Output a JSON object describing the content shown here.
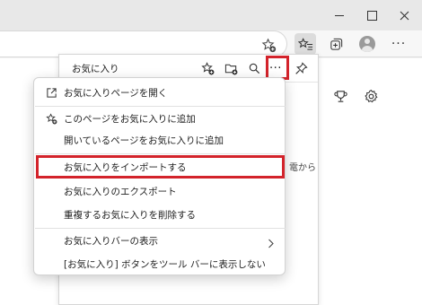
{
  "favorites_panel": {
    "title": "お気に入り",
    "background_text": "電から"
  },
  "menu": {
    "items": [
      {
        "label": "お気に入りページを開く",
        "icon": "open-external-icon"
      },
      {
        "label": "このページをお気に入りに追加",
        "icon": "star-add-icon"
      },
      {
        "label": "開いているページをお気に入りに追加",
        "icon": ""
      },
      {
        "label": "お気に入りをインポートする",
        "icon": "",
        "highlighted": true
      },
      {
        "label": "お気に入りのエクスポート",
        "icon": ""
      },
      {
        "label": "重複するお気に入りを削除する",
        "icon": ""
      },
      {
        "label": "お気に入りバーの表示",
        "icon": "",
        "has_submenu": true
      },
      {
        "label": "[お気に入り] ボタンをツール バーに表示しない",
        "icon": ""
      }
    ]
  },
  "colors": {
    "highlight_border": "#d3232b",
    "titlebar": "#e8e8e8",
    "menu_background": "#ffffff"
  }
}
